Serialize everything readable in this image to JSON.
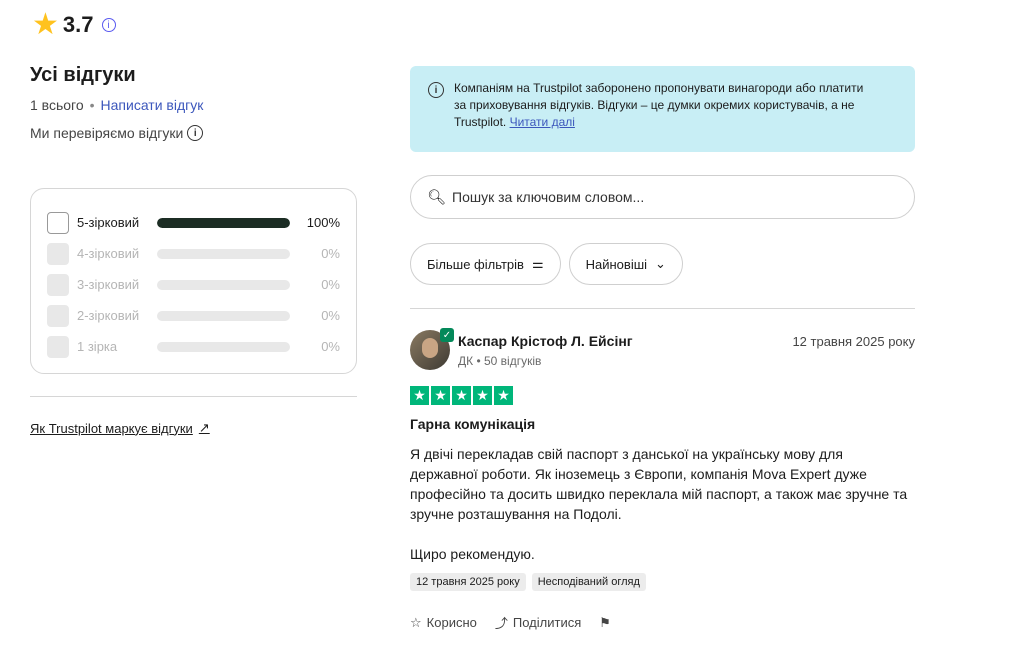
{
  "rating": {
    "score": "3.7",
    "star_color": "#ffc21e"
  },
  "left": {
    "title": "Усі відгуки",
    "count": "1 всього",
    "write_review": "Написати відгук",
    "verify": "Ми перевіряємо відгуки",
    "how_link": "Як Trustpilot маркує відгуки"
  },
  "distribution": [
    {
      "label": "5-зірковий",
      "percent": "100%",
      "fraction": 1.0
    },
    {
      "label": "4-зірковий",
      "percent": "0%",
      "fraction": 0
    },
    {
      "label": "3-зірковий",
      "percent": "0%",
      "fraction": 0
    },
    {
      "label": "2-зірковий",
      "percent": "0%",
      "fraction": 0
    },
    {
      "label": "1 зірка",
      "percent": "0%",
      "fraction": 0
    }
  ],
  "notice": {
    "text": "Компаніям на Trustpilot заборонено пропонувати винагороди або платити за приховування відгуків. Відгуки – це думки окремих користувачів, а не Trustpilot. ",
    "link": "Читати далі"
  },
  "search": {
    "placeholder": "Пошук за ключовим словом..."
  },
  "filters": {
    "more": "Більше фільтрів",
    "sort": "Найновіші"
  },
  "review": {
    "name": "Каспар Крістоф Л. Ейсінг",
    "meta": "ДК • 50 відгуків",
    "date": "12 травня 2025 року",
    "stars": 5,
    "title": "Гарна комунікація",
    "body": "Я двічі перекладав свій паспорт з данської на українську мову для державної роботи. Як іноземець з Європи, компанія Mova Expert дуже професійно та досить швидко переклала мій паспорт, а також має зручне та зручне розташування на Подолі.",
    "body2": "Щиро рекомендую.",
    "tags": [
      "12 травня 2025 року",
      "Несподіваний огляд"
    ],
    "actions": {
      "useful": "Корисно",
      "share": "Поділитися"
    }
  }
}
